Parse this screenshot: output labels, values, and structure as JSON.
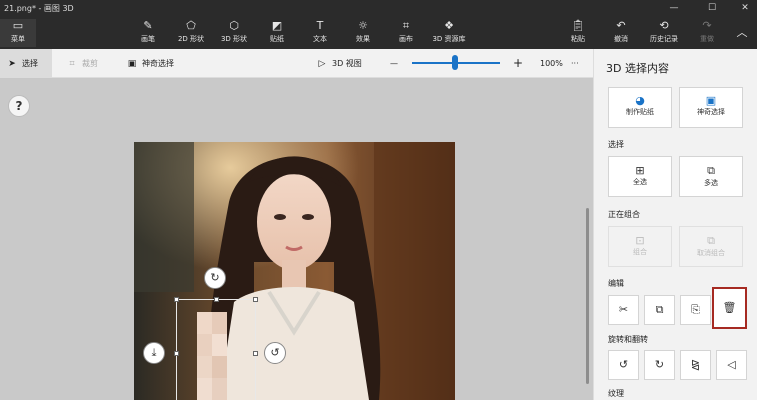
{
  "window": {
    "title": "21.png* - 画图 3D",
    "controls": {
      "minimize": "—",
      "maximize": "☐",
      "close": "✕"
    }
  },
  "ribbon": {
    "menu": {
      "icon": "folder-icon",
      "label": "菜单"
    },
    "tools": [
      {
        "icon": "brush-icon",
        "label": "画笔"
      },
      {
        "icon": "2d-shapes-icon",
        "label": "2D 形状"
      },
      {
        "icon": "3d-shapes-icon",
        "label": "3D 形状"
      },
      {
        "icon": "stickers-icon",
        "label": "贴纸"
      },
      {
        "icon": "text-icon",
        "label": "文本"
      },
      {
        "icon": "effects-icon",
        "label": "效果"
      },
      {
        "icon": "canvas-icon",
        "label": "画布"
      },
      {
        "icon": "3d-library-icon",
        "label": "3D 资源库"
      }
    ],
    "right": [
      {
        "icon": "paste-icon",
        "label": "粘贴"
      },
      {
        "icon": "undo-icon",
        "label": "撤消"
      },
      {
        "icon": "history-icon",
        "label": "历史记录"
      },
      {
        "icon": "redo-icon",
        "label": "重做"
      }
    ]
  },
  "toolbar": {
    "select": "选择",
    "crop": "裁剪",
    "magic_select": "神奇选择",
    "view_3d": "3D 视图",
    "zoom_minus": "—",
    "zoom_plus": "+",
    "zoom_value": "100%",
    "zoom_level": 0.45,
    "more": "···"
  },
  "canvas": {
    "help": "?"
  },
  "panel": {
    "title": "3D 选择内容",
    "top_buttons": {
      "make_sticker": "制作贴纸",
      "magic_select": "神奇选择"
    },
    "select_section": {
      "label": "选择",
      "select_all": "全选",
      "multi_select": "多选"
    },
    "group_section": {
      "label": "正在组合",
      "group": "组合",
      "ungroup": "取消组合"
    },
    "edit_section": {
      "label": "编辑"
    },
    "rotate_section": {
      "label": "旋转和翻转"
    },
    "texture_section": {
      "label": "纹理"
    }
  },
  "colors": {
    "accent": "#1a73c7",
    "highlight": "#a62a22",
    "ribbon": "#2b2b2b"
  }
}
